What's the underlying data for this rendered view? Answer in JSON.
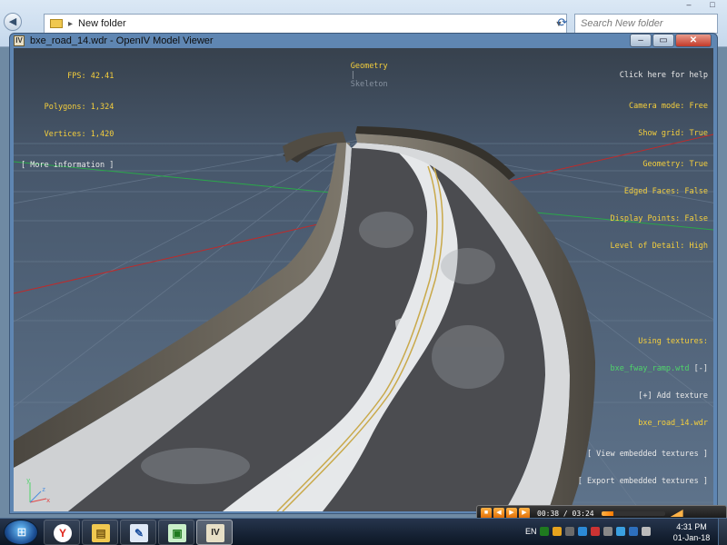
{
  "explorer": {
    "path": "New folder",
    "search_placeholder": "Search New folder"
  },
  "window": {
    "title": "bxe_road_14.wdr - OpenIV Model Viewer",
    "app_icon": "IV"
  },
  "overlay": {
    "fps_label": "FPS: 42.41",
    "polygons": "Polygons: 1,324",
    "vertices": "Vertices: 1,420",
    "more_info": "[ More information ]",
    "mode_geometry": "Geometry",
    "mode_separator": "|",
    "mode_skeleton": "Skeleton",
    "help": "Click here for help",
    "camera_mode": "Camera mode: Free",
    "show_grid": "Show grid: True",
    "geometry": "Geometry: True",
    "edged_faces": "Edged Faces: False",
    "display_points": "Display Points: False",
    "level_of_detail": "Level of Detail: High",
    "using_textures": "Using textures:",
    "texture_dict": "bxe_fway_ramp.wtd",
    "texture_dict_toggle": "[-]",
    "add_texture": "[+] Add texture",
    "model_file": "bxe_road_14.wdr",
    "view_embedded": "[ View embedded textures ]",
    "export_embedded": "[ Export embedded textures ]"
  },
  "media_player": {
    "time": "00:38 / 03:24",
    "progress": 0.19
  },
  "taskbar": {
    "language": "EN",
    "time": "4:31 PM",
    "date": "01-Jan-18",
    "apps": [
      {
        "name": "yandex-browser",
        "glyph": "Y",
        "color": "#e0251b",
        "bg": "#ffffff"
      },
      {
        "name": "file-explorer",
        "glyph": "▤",
        "color": "#7a5a12",
        "bg": "#f0c850"
      },
      {
        "name": "paint-program",
        "glyph": "✎",
        "color": "#1a4e9e",
        "bg": "#dfe9f7"
      },
      {
        "name": "monitor-app",
        "glyph": "▣",
        "color": "#1f7a1f",
        "bg": "#c9efc9"
      },
      {
        "name": "openiv",
        "glyph": "IV",
        "color": "#222222",
        "bg": "#e7dfc6"
      }
    ]
  },
  "colors": {
    "overlay_yellow": "#f5cf3c",
    "overlay_green": "#4fd36a",
    "road": "#4c4d51",
    "snow": "#e8eaec",
    "barrier": "#5e5a52"
  }
}
